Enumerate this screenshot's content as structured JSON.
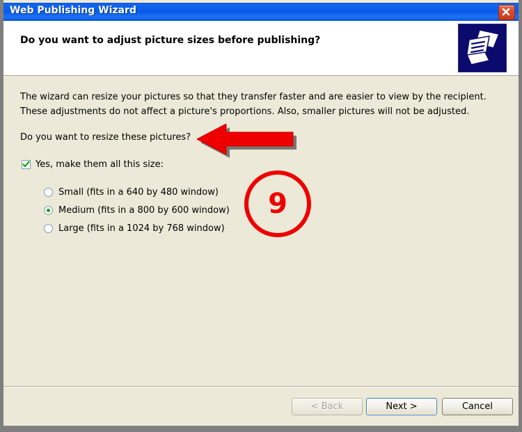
{
  "window": {
    "title": "Web Publishing Wizard",
    "close_icon": "close-icon"
  },
  "header": {
    "title": "Do you want to adjust picture sizes before publishing?",
    "icon": "web-publishing-icon"
  },
  "body": {
    "paragraph": "The wizard can resize your pictures so that they transfer faster and are easier to view by the recipient.  These adjustments do not affect a picture's proportions.  Also, smaller pictures will not be adjusted.",
    "question": "Do you want to resize these pictures?",
    "checkbox": {
      "label": "Yes, make them all this size:",
      "checked": true,
      "check_color": "#12a312"
    },
    "size_options": [
      {
        "label": "Small (fits in a 640 by 480 window)",
        "selected": false
      },
      {
        "label": "Medium (fits in a 800 by 600 window)",
        "selected": true
      },
      {
        "label": "Large (fits in a 1024 by 768 window)",
        "selected": false
      }
    ]
  },
  "footer": {
    "back_label": "< Back",
    "next_label": "Next >",
    "cancel_label": "Cancel"
  },
  "annotations": {
    "step_number": "9",
    "accent_color": "#ee0000",
    "arrow_direction": "left"
  },
  "colors": {
    "titlebar_blue": "#0a5ce8",
    "dialog_background": "#ece9d8",
    "header_background": "#ffffff",
    "desktop_grey": "#7f7f7f",
    "close_red": "#c43b1f",
    "icon_navy": "#0b0b6e"
  }
}
